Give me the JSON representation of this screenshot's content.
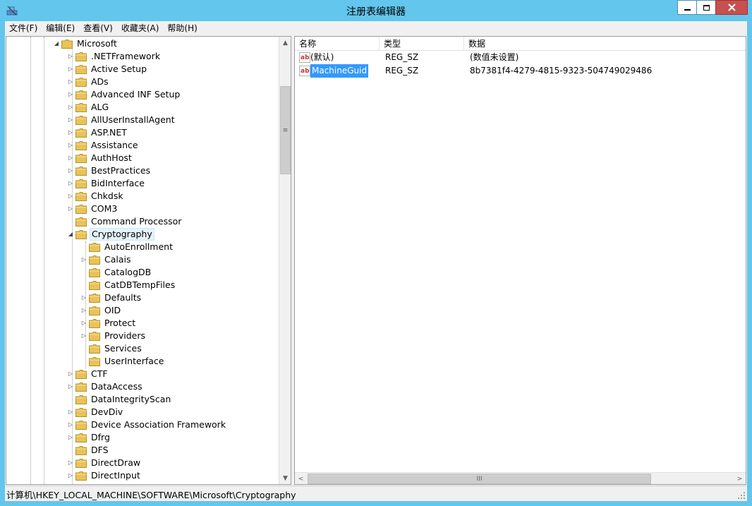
{
  "window": {
    "title": "注册表编辑器",
    "min_glyph": "—",
    "max_glyph": "□",
    "close_glyph": "✕"
  },
  "menu": [
    "文件(F)",
    "编辑(E)",
    "查看(V)",
    "收藏夹(A)",
    "帮助(H)"
  ],
  "tree": {
    "parent": "Microsoft",
    "items": [
      {
        "label": ".NETFramework",
        "level": 1,
        "expander": "collapsed"
      },
      {
        "label": "Active Setup",
        "level": 1,
        "expander": "collapsed"
      },
      {
        "label": "ADs",
        "level": 1,
        "expander": "collapsed"
      },
      {
        "label": "Advanced INF Setup",
        "level": 1,
        "expander": "collapsed"
      },
      {
        "label": "ALG",
        "level": 1,
        "expander": "collapsed"
      },
      {
        "label": "AllUserInstallAgent",
        "level": 1,
        "expander": "collapsed"
      },
      {
        "label": "ASP.NET",
        "level": 1,
        "expander": "collapsed"
      },
      {
        "label": "Assistance",
        "level": 1,
        "expander": "collapsed"
      },
      {
        "label": "AuthHost",
        "level": 1,
        "expander": "collapsed"
      },
      {
        "label": "BestPractices",
        "level": 1,
        "expander": "collapsed"
      },
      {
        "label": "BidInterface",
        "level": 1,
        "expander": "collapsed"
      },
      {
        "label": "Chkdsk",
        "level": 1,
        "expander": "collapsed"
      },
      {
        "label": "COM3",
        "level": 1,
        "expander": "collapsed"
      },
      {
        "label": "Command Processor",
        "level": 1,
        "expander": "none"
      },
      {
        "label": "Cryptography",
        "level": 1,
        "expander": "expanded",
        "selected": true
      },
      {
        "label": "AutoEnrollment",
        "level": 2,
        "expander": "none"
      },
      {
        "label": "Calais",
        "level": 2,
        "expander": "collapsed"
      },
      {
        "label": "CatalogDB",
        "level": 2,
        "expander": "none"
      },
      {
        "label": "CatDBTempFiles",
        "level": 2,
        "expander": "none"
      },
      {
        "label": "Defaults",
        "level": 2,
        "expander": "collapsed"
      },
      {
        "label": "OID",
        "level": 2,
        "expander": "collapsed"
      },
      {
        "label": "Protect",
        "level": 2,
        "expander": "collapsed"
      },
      {
        "label": "Providers",
        "level": 2,
        "expander": "collapsed"
      },
      {
        "label": "Services",
        "level": 2,
        "expander": "none"
      },
      {
        "label": "UserInterface",
        "level": 2,
        "expander": "none"
      },
      {
        "label": "CTF",
        "level": 1,
        "expander": "collapsed"
      },
      {
        "label": "DataAccess",
        "level": 1,
        "expander": "collapsed"
      },
      {
        "label": "DataIntegrityScan",
        "level": 1,
        "expander": "none"
      },
      {
        "label": "DevDiv",
        "level": 1,
        "expander": "collapsed"
      },
      {
        "label": "Device Association Framework",
        "level": 1,
        "expander": "collapsed"
      },
      {
        "label": "Dfrg",
        "level": 1,
        "expander": "collapsed"
      },
      {
        "label": "DFS",
        "level": 1,
        "expander": "none"
      },
      {
        "label": "DirectDraw",
        "level": 1,
        "expander": "collapsed"
      },
      {
        "label": "DirectInput",
        "level": 1,
        "expander": "collapsed"
      }
    ]
  },
  "values": {
    "columns": [
      "名称",
      "类型",
      "数据"
    ],
    "rows": [
      {
        "name": "(默认)",
        "type": "REG_SZ",
        "data": "(数值未设置)",
        "selected": false
      },
      {
        "name": "MachineGuid",
        "type": "REG_SZ",
        "data": "8b7381f4-4279-4815-9323-504749029486",
        "selected": true
      }
    ]
  },
  "scroll": {
    "thumb_glyph": "≡",
    "hthumb_glyph": "III",
    "up": "▲",
    "down": "▼",
    "left": "<",
    "right": ">"
  },
  "status": {
    "path": "计算机\\HKEY_LOCAL_MACHINE\\SOFTWARE\\Microsoft\\Cryptography"
  },
  "colors": {
    "frame": "#63c6ec",
    "selection": "#3399ff",
    "folder": "#e8c35a",
    "close": "#c75050"
  }
}
